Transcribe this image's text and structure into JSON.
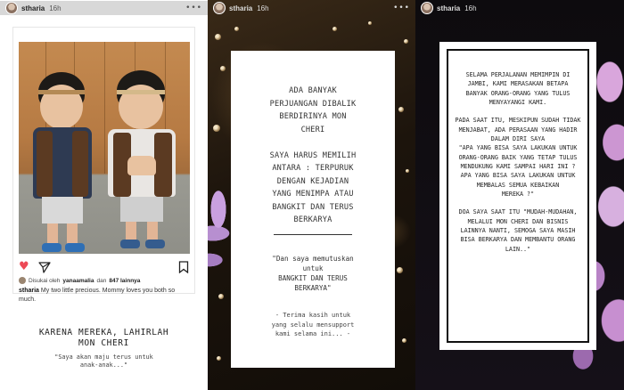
{
  "stories": [
    {
      "header": {
        "username": "stharia",
        "time": "16h",
        "more_icon": "more-dots-icon"
      },
      "post": {
        "likes_prefix": "Disukai oleh",
        "likes_user": "yanaamalia",
        "likes_middle": "dan",
        "likes_count": "847 lainnya",
        "caption_user": "stharia",
        "caption_text": "My two little precious. Mommy loves you both so much.",
        "icons": [
          "heart-icon",
          "send-icon",
          "bookmark-icon"
        ]
      },
      "title": "KARENA MEREKA, LAHIRLAH\nMON CHERI",
      "quote": "\"Saya akan maju terus untuk\nanak-anak...\""
    },
    {
      "header": {
        "username": "stharia",
        "time": "16h",
        "more_icon": "more-dots-icon"
      },
      "card_top": "ADA BANYAK\nPERJUANGAN DIBALIK\nBERDIRINYA MON\nCHERI\n\nSAYA HARUS MEMILIH\nANTARA : TERPURUK\nDENGAN KEJADIAN\nYANG MENIMPA ATAU\nBANGKIT DAN TERUS\nBERKARYA",
      "card_mid": "\"Dan saya memutuskan\nuntuk\nBANGKIT DAN TERUS\nBERKARYA\"",
      "card_bot": "- Terima kasih untuk\nyang selalu mensupport\nkami selama ini... -"
    },
    {
      "header": {
        "username": "stharia",
        "time": "16h"
      },
      "card_text": "SELAMA PERJALANAN MEMIMPIN DI\nJAMBI, KAMI MERASAKAN BETAPA\nBANYAK ORANG-ORANG YANG TULUS\nMENYAYANGI KAMI.\n\nPADA SAAT ITU, MESKIPUN SUDAH TIDAK\nMENJABAT, ADA PERASAAN YANG HADIR\nDALAM DIRI SAYA\n\"APA YANG BISA SAYA LAKUKAN UNTUK\nORANG-ORANG BAIK YANG TETAP TULUS\nMENDUKUNG KAMI SAMPAI HARI INI ?\nAPA YANG BISA SAYA LAKUKAN UNTUK\nMEMBALAS SEMUA KEBAIKAN\nMEREKA ?\"\n\nDOA SAYA SAAT ITU \"MUDAH-MUDAHAN,\nMELALUI MON CHERI DAN BISNIS\nLAINNYA NANTI, SEMOGA SAYA MASIH\nBISA BERKARYA DAN MEMBANTU ORANG\nLAIN..\""
    }
  ]
}
